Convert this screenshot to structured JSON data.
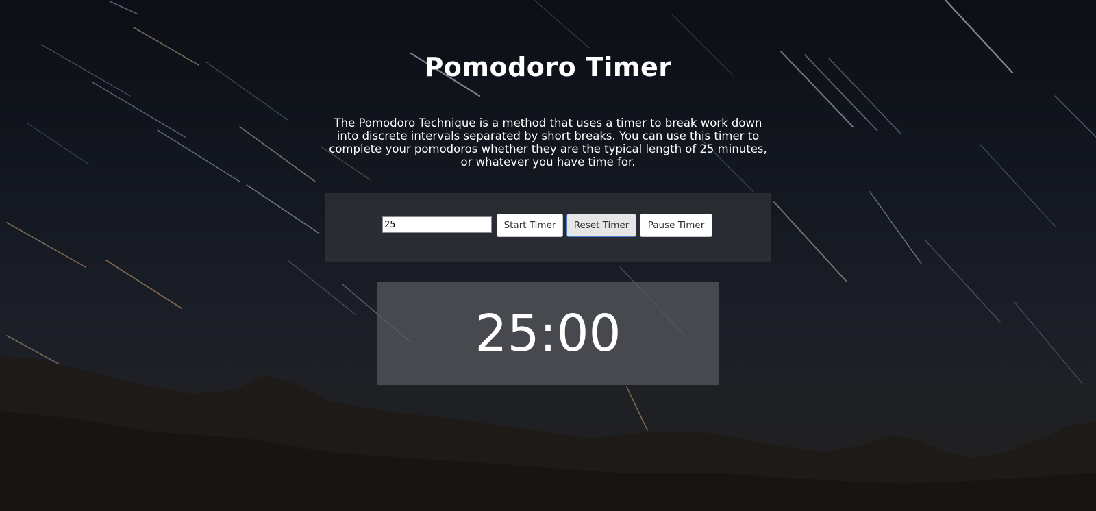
{
  "page": {
    "title": "Pomodoro Timer",
    "description": "The Pomodoro Technique is a method that uses a timer to break work down into discrete intervals separated by short breaks. You can use this timer to complete your pomodoros whether they are the typical length of 25 minutes, or whatever you have time for."
  },
  "controls": {
    "minutes_value": "25",
    "start_label": "Start Timer",
    "reset_label": "Reset Timer",
    "pause_label": "Pause Timer"
  },
  "timer": {
    "display": "25:00"
  },
  "colors": {
    "text": "#ffffff",
    "panel": "#3a3c40",
    "timer_panel": "#56585c",
    "focus_border": "#4a7fd0",
    "background_sky": "#0f1218"
  },
  "background": {
    "description_icon": "star-trails-night-sky"
  }
}
